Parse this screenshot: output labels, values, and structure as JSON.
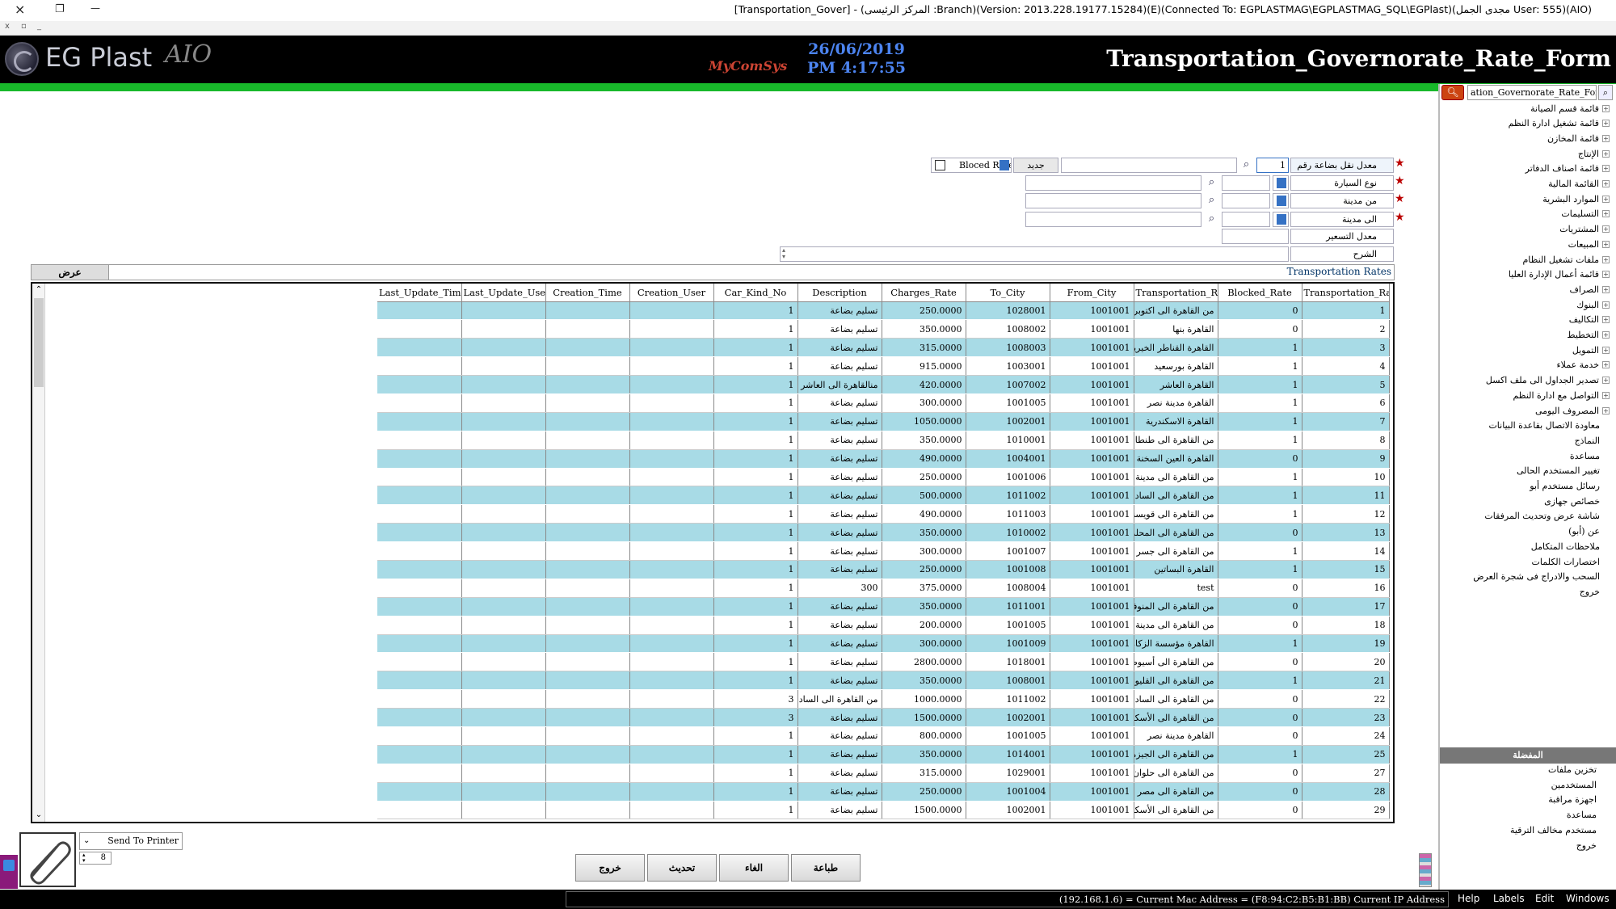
{
  "window": {
    "title": "[Transportation_Gover] - (المركز الرئيسى :Branch)(Version: 2013.228.19177.15284)(E)(Connected To: EGPLASTMAG\\EGPLASTMAG_SQL\\EGPlast)(مجدى الجمل User: 555)(AIO)",
    "close_icon": "×",
    "restore_icon": "❐",
    "minimize_icon": "—",
    "sub_close": "x",
    "sub_restore": "▫",
    "sub_min": "_"
  },
  "header": {
    "logo_text": "EG Plast",
    "logo_suffix": "AIO",
    "vendor": "MyComSys",
    "date": "26/06/2019",
    "time": "PM 4:17:55",
    "form_title": "Transportation_Governorate_Rate_Form"
  },
  "tree": {
    "search_value": "ation_Governorate_Rate_Form",
    "search_icon": "search-icon",
    "items": [
      "قائمة قسم الصيانة",
      "قائمة تشغيل ادارة النظم",
      "قائمة المخازن",
      "الإنتاج",
      "قائمة اصناف الدفاتر",
      "القائمة المالية",
      "الموارد البشرية",
      "التسليمات",
      "المشتريات",
      "المبيعات",
      "ملفات تشغيل النظام",
      "قائمة أعمال الإدارة العليا",
      "الصراف",
      "البنوك",
      "التكاليف",
      "التخطيط",
      "التمويل",
      "خدمة عملاء",
      "تصدير الجداول الى ملف اكسل",
      "التواصل مع ادارة النظم",
      "المصروف اليومى"
    ],
    "leaves": [
      "معاودة الاتصال بقاعدة البيانات",
      "النماذج",
      "مساعدة",
      "تغيير المستخدم الحالى",
      "رسائل مستخدم أبو",
      "خصائص جهازى",
      "شاشة عرض وتحديث المرفقات",
      "عن (أبو)",
      "ملاحظات المتكامل",
      "اختصارات الكلمات",
      "السحب والادراج فى شجرة العرض",
      "خروج"
    ],
    "favorites_title": "المفضلة",
    "favorites": [
      "تخزين ملفات",
      "المستخدمين",
      "اجهزة مراقبة",
      "مساعدة",
      "مستخدم مخالف الترقية",
      "خروج"
    ]
  },
  "form": {
    "rate_no_label": "معدل نقل بضاعة رقم",
    "rate_no_value": "1",
    "new_button": "جديد",
    "blocked_label": "Bloced Rate",
    "car_type_label": "نوع السيارة",
    "from_city_label": "من مدينة",
    "to_city_label": "الى مدينة",
    "rate_label": "معدل التسعير",
    "desc_label": "الشرح"
  },
  "section": {
    "caption": "Transportation Rates",
    "show_button": "عرض"
  },
  "grid": {
    "columns": [
      "Last_Update_Time",
      "Last_Update_User",
      "Creation_Time",
      "Creation_User",
      "Car_Kind_No",
      "Description",
      "Charges_Rate",
      "To_City",
      "From_City",
      "Transportation_Rate_N",
      "Blocked_Rate",
      "Transportation_Rate_I"
    ],
    "rows": [
      [
        "",
        "",
        "",
        "",
        "1",
        "تسليم بضاعة",
        "250.0000",
        "1028001",
        "1001001",
        "من القاهرة الى اكتوبر",
        "0",
        "1"
      ],
      [
        "",
        "",
        "",
        "",
        "1",
        "تسليم بضاعة",
        "350.0000",
        "1008002",
        "1001001",
        "القاهرة بنها",
        "0",
        "2"
      ],
      [
        "",
        "",
        "",
        "",
        "1",
        "تسليم بضاعة",
        "315.0000",
        "1008003",
        "1001001",
        "القاهرة القناطر الخيرية",
        "1",
        "3"
      ],
      [
        "",
        "",
        "",
        "",
        "1",
        "تسليم بضاعة",
        "915.0000",
        "1003001",
        "1001001",
        "القاهرة بورسعيد",
        "1",
        "4"
      ],
      [
        "",
        "",
        "",
        "",
        "1",
        "منالقاهرة الى العاشر",
        "420.0000",
        "1007002",
        "1001001",
        "القاهرة العاشر",
        "1",
        "5"
      ],
      [
        "",
        "",
        "",
        "",
        "1",
        "تسليم بضاعة",
        "300.0000",
        "1001005",
        "1001001",
        "القاهرة مدينة نصر",
        "1",
        "6"
      ],
      [
        "",
        "",
        "",
        "",
        "1",
        "تسليم بضاعة",
        "1050.0000",
        "1002001",
        "1001001",
        "القاهرة الاسكندرية",
        "1",
        "7"
      ],
      [
        "",
        "",
        "",
        "",
        "1",
        "تسليم بضاعة",
        "350.0000",
        "1010001",
        "1001001",
        "من القاهرة الى طنطا",
        "1",
        "8"
      ],
      [
        "",
        "",
        "",
        "",
        "1",
        "تسليم بضاعة",
        "490.0000",
        "1004001",
        "1001001",
        "القاهرة العين السخنة",
        "0",
        "9"
      ],
      [
        "",
        "",
        "",
        "",
        "1",
        "تسليم بضاعة",
        "250.0000",
        "1001006",
        "1001001",
        "من القاهرة الى مدينة بدر",
        "1",
        "10"
      ],
      [
        "",
        "",
        "",
        "",
        "1",
        "تسليم بضاعة",
        "500.0000",
        "1011002",
        "1001001",
        "من القاهرة الى السادات",
        "1",
        "11"
      ],
      [
        "",
        "",
        "",
        "",
        "1",
        "تسليم بضاعة",
        "490.0000",
        "1011003",
        "1001001",
        "من القاهرة الى قويسنا",
        "1",
        "12"
      ],
      [
        "",
        "",
        "",
        "",
        "1",
        "تسليم بضاعة",
        "350.0000",
        "1010002",
        "1001001",
        "من القاهرة الى المحلة الكبرى",
        "0",
        "13"
      ],
      [
        "",
        "",
        "",
        "",
        "1",
        "تسليم بضاعة",
        "300.0000",
        "1001007",
        "1001001",
        "من القاهرة الى جسر",
        "1",
        "14"
      ],
      [
        "",
        "",
        "",
        "",
        "1",
        "تسليم بضاعة",
        "250.0000",
        "1001008",
        "1001001",
        "القاهرة البساتين",
        "1",
        "15"
      ],
      [
        "",
        "",
        "",
        "",
        "1",
        "300",
        "375.0000",
        "1008004",
        "1001001",
        "test",
        "0",
        "16"
      ],
      [
        "",
        "",
        "",
        "",
        "1",
        "تسليم بضاعة",
        "350.0000",
        "1011001",
        "1001001",
        "من القاهرة الى المنوفية",
        "0",
        "17"
      ],
      [
        "",
        "",
        "",
        "",
        "1",
        "تسليم بضاعة",
        "200.0000",
        "1001005",
        "1001001",
        "من القاهرة الى مدينة نصر",
        "0",
        "18"
      ],
      [
        "",
        "",
        "",
        "",
        "1",
        "تسليم بضاعة",
        "300.0000",
        "1001009",
        "1001001",
        "القاهرة مؤسسة الزكاة",
        "1",
        "19"
      ],
      [
        "",
        "",
        "",
        "",
        "1",
        "تسليم بضاعة",
        "2800.0000",
        "1018001",
        "1001001",
        "من القاهرة الى أسيوط",
        "0",
        "20"
      ],
      [
        "",
        "",
        "",
        "",
        "1",
        "تسليم بضاعة",
        "350.0000",
        "1008001",
        "1001001",
        "من القاهرة الى القليوبية",
        "1",
        "21"
      ],
      [
        "",
        "",
        "",
        "",
        "3",
        "من القاهرة الى السادات",
        "1000.0000",
        "1011002",
        "1001001",
        "من القاهرة الى السادات",
        "0",
        "22"
      ],
      [
        "",
        "",
        "",
        "",
        "3",
        "تسليم بضاعة",
        "1500.0000",
        "1002001",
        "1001001",
        "من القاهرة الى الأسكندرية",
        "0",
        "23"
      ],
      [
        "",
        "",
        "",
        "",
        "1",
        "تسليم بضاعة",
        "800.0000",
        "1001005",
        "1001001",
        "القاهرة مدينة نصر",
        "0",
        "24"
      ],
      [
        "",
        "",
        "",
        "",
        "1",
        "تسليم بضاعة",
        "350.0000",
        "1014001",
        "1001001",
        "من القاهرة الى الجيزة",
        "1",
        "25"
      ],
      [
        "",
        "",
        "",
        "",
        "1",
        "تسليم بضاعة",
        "315.0000",
        "1029001",
        "1001001",
        "من القاهرة الى حلوان",
        "0",
        "27"
      ],
      [
        "",
        "",
        "",
        "",
        "1",
        "تسليم بضاعة",
        "250.0000",
        "1001004",
        "1001001",
        "من القاهرة الى مصر",
        "0",
        "28"
      ],
      [
        "",
        "",
        "",
        "",
        "1",
        "تسليم بضاعة",
        "1500.0000",
        "1002001",
        "1001001",
        "من القاهرة الى الأسكندرية",
        "0",
        "29"
      ]
    ]
  },
  "bottom": {
    "send_to_printer": "Send To Printer",
    "copies": "8",
    "exit": "خروج",
    "refresh": "تحديث",
    "cancel": "الغاء",
    "print": "طباعة"
  },
  "statusbar": {
    "ip_text": "(192.168.1.6) = Current Mac Address = (F8:94:C2:B5:B1:BB) Current IP Address",
    "menus": [
      "Help",
      "Labels",
      "Edit",
      "Windows"
    ]
  },
  "colors": {
    "header_bg": "#000000",
    "accent_green": "#18b82a",
    "row_alt": "#a8dbe6",
    "date_blue": "#4c84f0"
  }
}
